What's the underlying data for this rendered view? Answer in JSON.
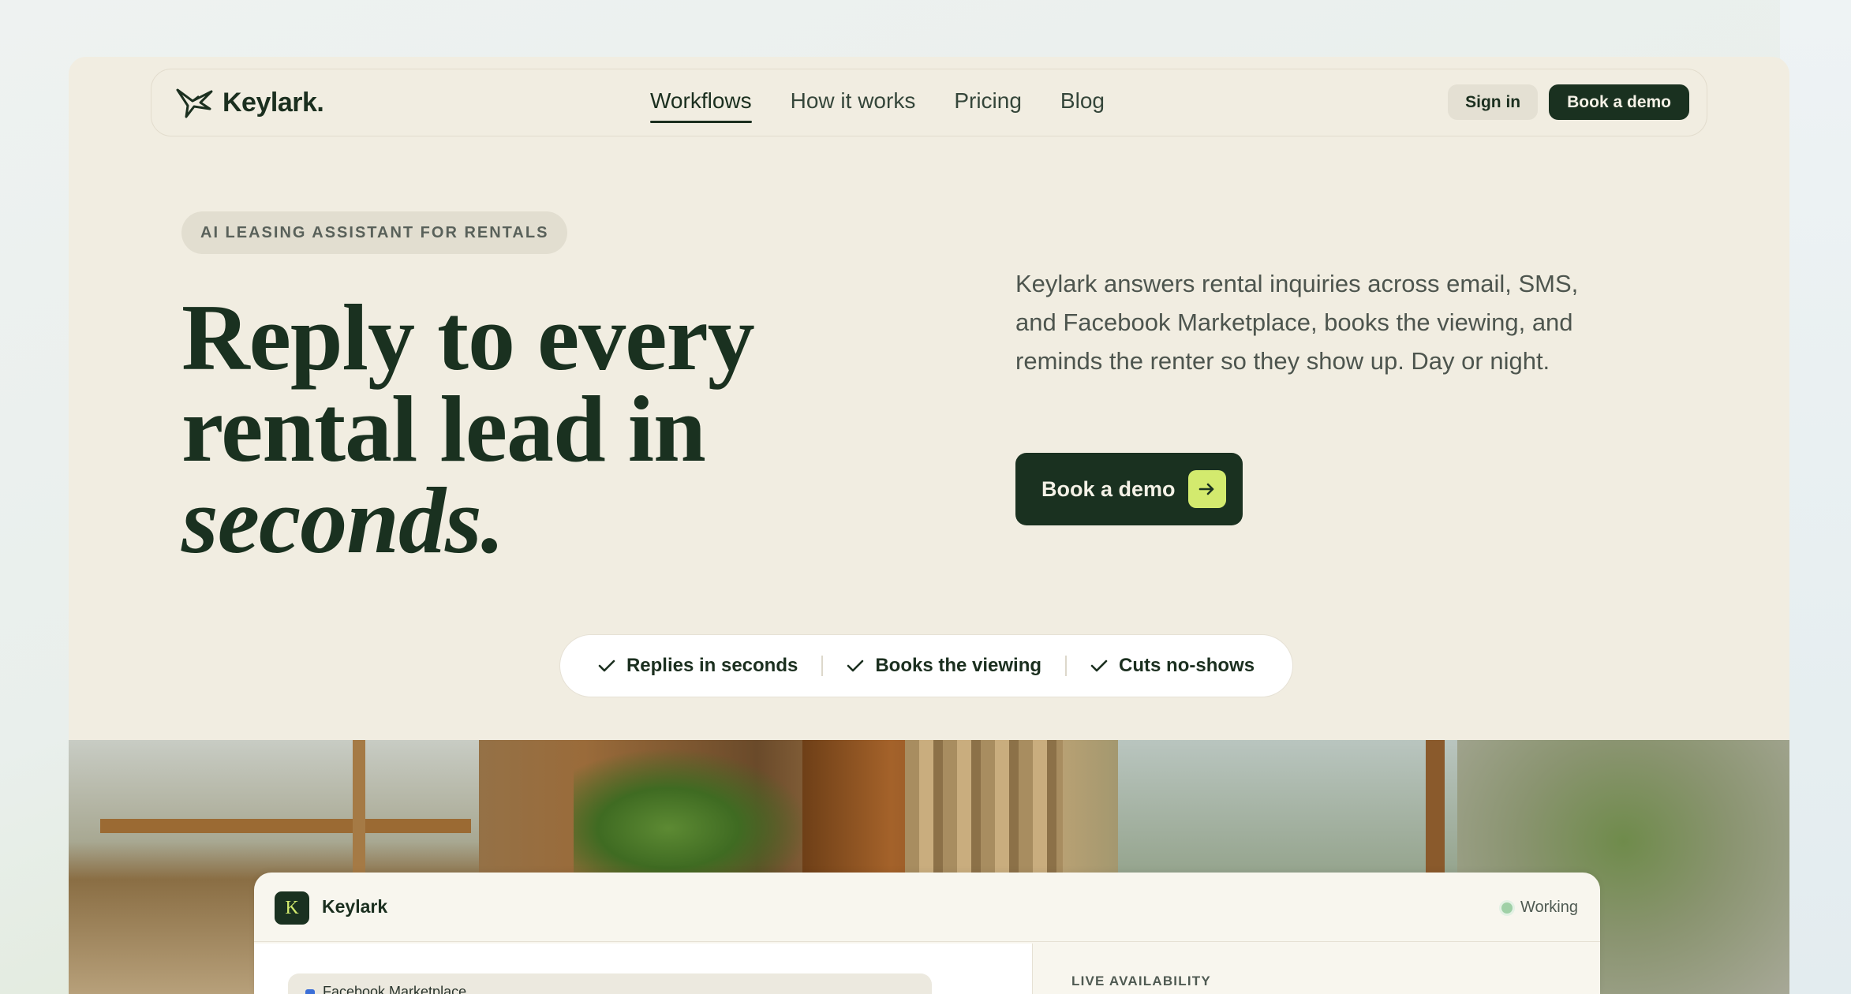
{
  "brand": {
    "name": "Keylark."
  },
  "nav": {
    "links": [
      {
        "label": "Workflows",
        "active": true
      },
      {
        "label": "How it works",
        "active": false
      },
      {
        "label": "Pricing",
        "active": false
      },
      {
        "label": "Blog",
        "active": false
      }
    ],
    "sign_in": "Sign in",
    "book_demo": "Book a demo"
  },
  "hero": {
    "eyebrow": "AI LEASING ASSISTANT FOR RENTALS",
    "headline_line1": "Reply to every",
    "headline_line2": "rental lead in",
    "headline_line3": "seconds.",
    "description": "Keylark answers rental inquiries across email, SMS, and Facebook Marketplace, books the viewing, and reminds the renter so they show up. Day or night.",
    "cta": "Book a demo"
  },
  "features": [
    {
      "label": "Replies in seconds",
      "icon": "check-icon"
    },
    {
      "label": "Books the viewing",
      "icon": "check-icon"
    },
    {
      "label": "Cuts no-shows",
      "icon": "check-icon"
    }
  ],
  "preview": {
    "badge": "K",
    "app_name": "Keylark",
    "status": "Working",
    "channel": "Facebook Marketplace",
    "right_section": "LIVE AVAILABILITY"
  },
  "colors": {
    "brand_dark": "#1a3120",
    "accent_lime": "#d3ea6e",
    "card_bg": "#f1ede1",
    "status_green": "#9fd0a6"
  }
}
